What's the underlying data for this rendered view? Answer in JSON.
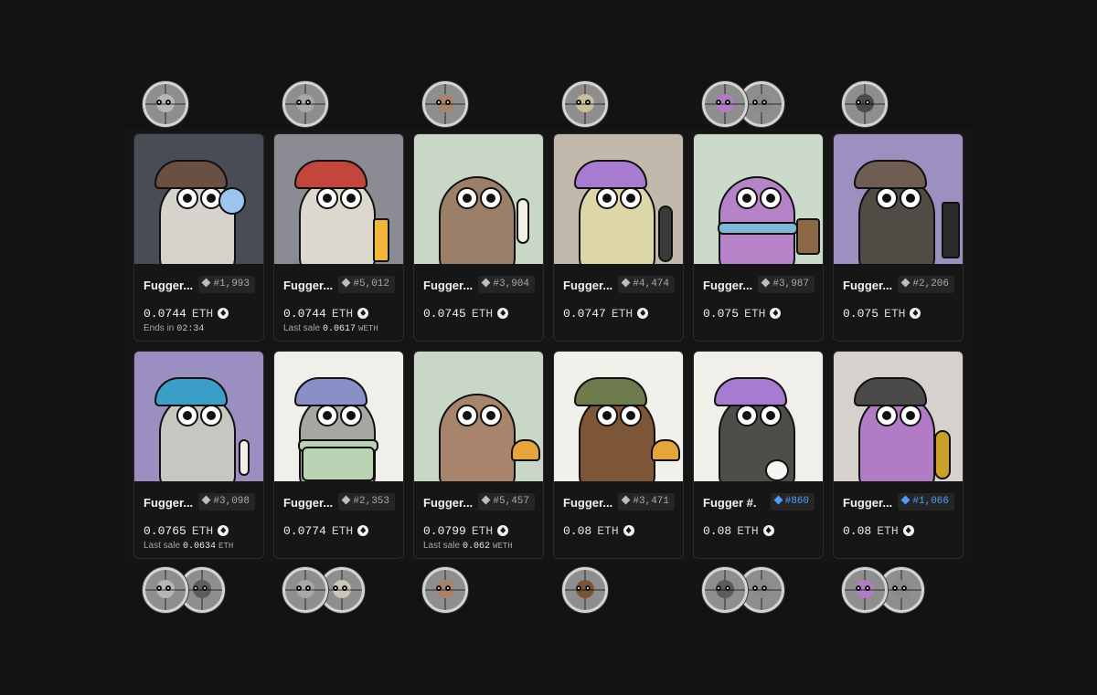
{
  "currency": "ETH",
  "top_tokens": [
    [
      "#b6b6b6"
    ],
    [
      "#a8a8a8"
    ],
    [
      "#a8836a"
    ],
    [
      "#c7c09a"
    ],
    [
      "#b27cc4",
      "#8a8a8a"
    ],
    [
      "#4a4a47"
    ]
  ],
  "bottom_tokens": [
    [
      "#b6b6b6",
      "#5c5c5c"
    ],
    [
      "#a8a8a8",
      "#c9c6b8"
    ],
    [
      "#a8836a"
    ],
    [
      "#7a5434"
    ],
    [
      "#5c5c5c",
      "#8a8a8a"
    ],
    [
      "#b27cc4",
      "#8a8a8a"
    ]
  ],
  "cards": [
    {
      "name": "Fugger...",
      "badge": "#1,993",
      "badge_color": "gray",
      "price": "0.0744",
      "sub_type": "ends",
      "sub_label": "Ends in",
      "sub_value": "02:34",
      "bg": "#4a4c55",
      "skin": "#d6d3cc",
      "hat": "#6a5043",
      "prop": "bubble"
    },
    {
      "name": "Fugger...",
      "badge": "#5,012",
      "badge_color": "gray",
      "price": "0.0744",
      "sub_type": "last",
      "sub_label": "Last sale",
      "sub_value": "0.0617",
      "sub_unit": "WETH",
      "bg": "#8b8c93",
      "skin": "#dcd8d0",
      "hat": "#c2463c",
      "prop": "pencil"
    },
    {
      "name": "Fugger...",
      "badge": "#3,904",
      "badge_color": "gray",
      "price": "0.0745",
      "sub_type": "none",
      "bg": "#c9d8c6",
      "skin": "#9b7f68",
      "hat": "",
      "prop": "feather"
    },
    {
      "name": "Fugger...",
      "badge": "#4,474",
      "badge_color": "gray",
      "price": "0.0747",
      "sub_type": "none",
      "bg": "#c2b9ac",
      "skin": "#dcd6a8",
      "hat": "#a77bd0",
      "prop": "skate"
    },
    {
      "name": "Fugger...",
      "badge": "#3,987",
      "badge_color": "gray",
      "price": "0.075",
      "sub_type": "none",
      "bg": "#cbdacb",
      "skin": "#b682c8",
      "hat": "",
      "prop": "coffee"
    },
    {
      "name": "Fugger...",
      "badge": "#2,206",
      "badge_color": "gray",
      "price": "0.075",
      "sub_type": "none",
      "bg": "#9b90c0",
      "skin": "#4f4c45",
      "hat": "#6f5c52",
      "prop": "keyboard"
    },
    {
      "name": "Fugger...",
      "badge": "#3,098",
      "badge_color": "gray",
      "price": "0.0765",
      "sub_type": "last",
      "sub_label": "Last sale",
      "sub_value": "0.0634",
      "sub_unit": "ETH",
      "bg": "#9a8fc0",
      "skin": "#c8c6c0",
      "hat": "#3a9ec9",
      "prop": "bone"
    },
    {
      "name": "Fugger...",
      "badge": "#2,353",
      "badge_color": "gray",
      "price": "0.0774",
      "sub_type": "none",
      "bg": "#f0efe9",
      "skin": "#a8a6a0",
      "hat": "#8a8fc8",
      "prop": "shirt"
    },
    {
      "name": "Fugger...",
      "badge": "#5,457",
      "badge_color": "gray",
      "price": "0.0799",
      "sub_type": "last",
      "sub_label": "Last sale",
      "sub_value": "0.062",
      "sub_unit": "WETH",
      "bg": "#c9d8c6",
      "skin": "#a8846c",
      "hat": "",
      "prop": "taco"
    },
    {
      "name": "Fugger...",
      "badge": "#3,471",
      "badge_color": "gray",
      "price": "0.08",
      "sub_type": "none",
      "bg": "#f2f0ea",
      "skin": "#7c5637",
      "hat": "#6d7a4c",
      "prop": "taco"
    },
    {
      "name": "Fugger #...",
      "badge": "#860",
      "badge_color": "blue",
      "price": "0.08",
      "sub_type": "none",
      "bg": "#f0efe9",
      "skin": "#4f4d48",
      "hat": "#a77bd0",
      "prop": "duck"
    },
    {
      "name": "Fugger...",
      "badge": "#1,066",
      "badge_color": "blue",
      "price": "0.08",
      "sub_type": "none",
      "bg": "#d6d1cc",
      "skin": "#b27cc4",
      "hat": "#4a4a4a",
      "prop": "mic"
    }
  ]
}
